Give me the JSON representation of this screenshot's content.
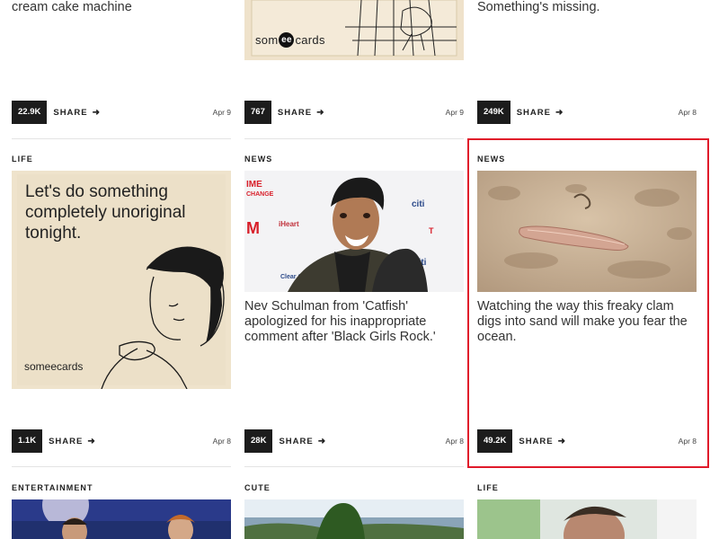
{
  "row1": {
    "col1": {
      "title_line": "cream cake machine",
      "count": "22.9K",
      "share": "SHARE",
      "date": "Apr 9"
    },
    "col2": {
      "count": "767",
      "share": "SHARE",
      "date": "Apr 9",
      "logo": "someecards"
    },
    "col3": {
      "title_line": "Something's missing.",
      "count": "249K",
      "share": "SHARE",
      "date": "Apr 8"
    }
  },
  "row2": {
    "col1": {
      "category": "LIFE",
      "ecard_text": "Let's do something completely unoriginal tonight.",
      "logo": "someecards",
      "count": "1.1K",
      "share": "SHARE",
      "date": "Apr 8"
    },
    "col2": {
      "category": "NEWS",
      "title": "Nev Schulman from 'Catfish' apologized for his inappropriate comment after 'Black Girls Rock.'",
      "count": "28K",
      "share": "SHARE",
      "date": "Apr 8"
    },
    "col3": {
      "category": "NEWS",
      "title": "Watching the way this freaky clam digs into sand will make you fear the ocean.",
      "count": "49.2K",
      "share": "SHARE",
      "date": "Apr 8"
    }
  },
  "row3": {
    "col1": {
      "category": "ENTERTAINMENT"
    },
    "col2": {
      "category": "CUTE"
    },
    "col3": {
      "category": "LIFE"
    }
  },
  "icons": {
    "share_arrow": "arrow-right-icon"
  },
  "colors": {
    "count_bg": "#1c1c1c",
    "highlight": "#e0192a"
  }
}
